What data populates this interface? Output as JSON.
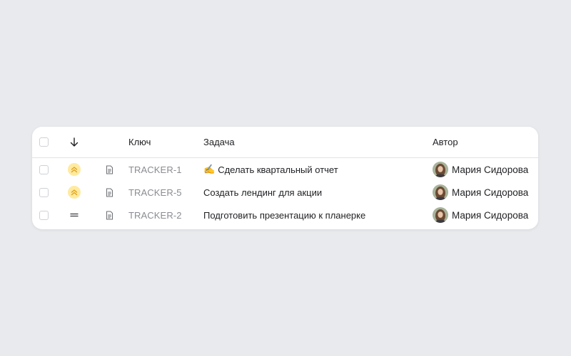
{
  "table": {
    "columns": {
      "sort_icon": "arrow-down-icon",
      "key": "Ключ",
      "task": "Задача",
      "author": "Автор"
    },
    "rows": [
      {
        "priority": "high",
        "priority_icon": "chevrons-up-icon",
        "type_icon": "document-icon",
        "key": "TRACKER-1",
        "task_emoji": "✍️",
        "task": "Сделать квартальный отчет",
        "author": "Мария Сидорова"
      },
      {
        "priority": "high",
        "priority_icon": "chevrons-up-icon",
        "type_icon": "document-icon",
        "key": "TRACKER-5",
        "task": "Создать лендинг для акции",
        "author": "Мария Сидорова"
      },
      {
        "priority": "normal",
        "priority_icon": "equals-icon",
        "type_icon": "document-icon",
        "key": "TRACKER-2",
        "task": "Подготовить презентацию к планерке",
        "author": "Мария Сидорова"
      }
    ]
  },
  "colors": {
    "background": "#e9eaed",
    "high_priority_badge": "#ffeaa0",
    "high_priority_icon": "#e0a21b",
    "key_text": "#8a8c92"
  }
}
